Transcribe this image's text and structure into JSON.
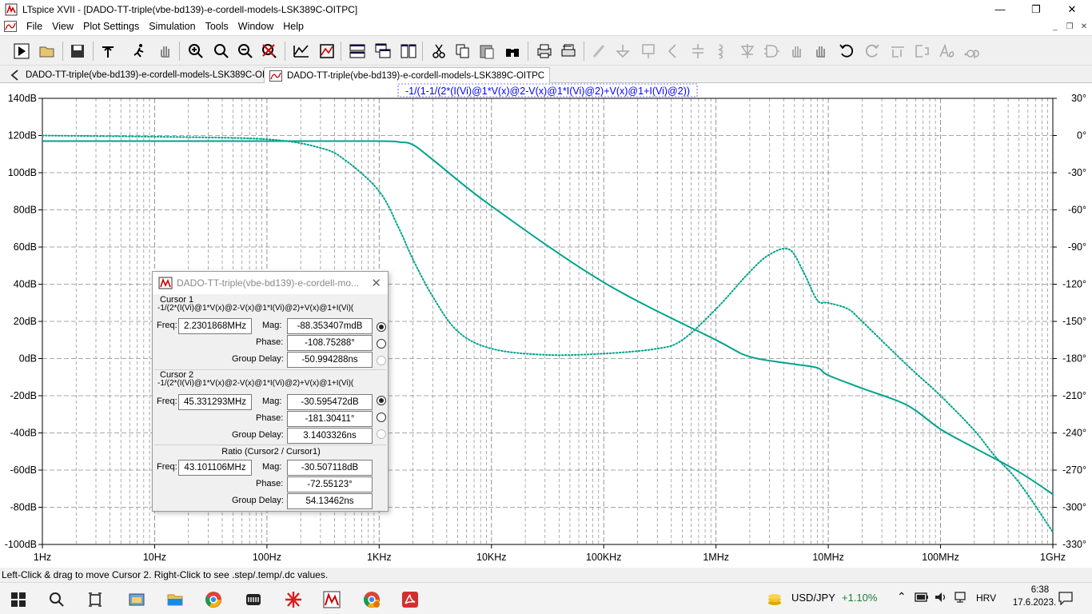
{
  "window": {
    "title": "LTspice XVII - [DADO-TT-triple(vbe-bd139)-e-cordell-models-LSK389C-OITPC]",
    "minimize": "—",
    "restore": "❐",
    "close": "✕"
  },
  "menu": {
    "items": [
      "File",
      "View",
      "Plot Settings",
      "Simulation",
      "Tools",
      "Window",
      "Help"
    ],
    "mdi_min": "_",
    "mdi_restore": "❐",
    "mdi_close": "✕"
  },
  "toolbar": {
    "icons": [
      "run-icon",
      "open-icon",
      "save-icon",
      "control-panel-icon",
      "halt-icon",
      "pan-icon",
      "zoom-in-icon",
      "zoom-area-icon",
      "zoom-out-icon",
      "zoom-cancel-icon",
      "autorange-icon",
      "plot-settings-icon",
      "tile-horizontal-icon",
      "cascade-icon",
      "tile-vertical-icon",
      "cut-icon",
      "copy-icon",
      "paste-icon",
      "find-icon",
      "print-icon",
      "print-setup-icon",
      "wire-icon",
      "ground-icon",
      "label-icon",
      "resistor-icon",
      "capacitor-icon",
      "inductor-icon",
      "diode-icon",
      "component-icon",
      "move-icon",
      "drag-icon",
      "undo-icon",
      "redo-icon",
      "rotate-icon",
      "mirror-icon",
      "text-icon",
      "spice-directive-icon"
    ]
  },
  "tabs": [
    {
      "label": "DADO-TT-triple(vbe-bd139)-e-cordell-models-LSK389C-OITPC",
      "icon": "schematic-icon"
    },
    {
      "label": "DADO-TT-triple(vbe-bd139)-e-cordell-models-LSK389C-OITPC",
      "icon": "waveform-icon"
    }
  ],
  "chart_data": {
    "type": "line",
    "title": "-1/(1-1/(2*(I(Vi)@1*V(x)@2-V(x)@1*I(Vi)@2)+V(x)@1+I(Vi)@2))",
    "x_scale": "log",
    "xlim": [
      1,
      1000000000
    ],
    "x_ticks": [
      "1Hz",
      "10Hz",
      "100Hz",
      "1KHz",
      "10KHz",
      "100KHz",
      "1MHz",
      "10MHz",
      "100MHz",
      "1GHz"
    ],
    "ylim_left": [
      -100,
      140
    ],
    "y_ticks_left": [
      "140dB",
      "120dB",
      "100dB",
      "80dB",
      "60dB",
      "40dB",
      "20dB",
      "0dB",
      "-20dB",
      "-40dB",
      "-60dB",
      "-80dB",
      "-100dB"
    ],
    "ylim_right": [
      -330,
      30
    ],
    "y_ticks_right": [
      "30°",
      "0°",
      "-30°",
      "-60°",
      "-90°",
      "-120°",
      "-150°",
      "-180°",
      "-210°",
      "-240°",
      "-270°",
      "-300°",
      "-330°"
    ],
    "grid": true,
    "color": "#00a38c",
    "series": [
      {
        "name": "magnitude",
        "style": "solid",
        "axis": "left",
        "x": [
          1,
          10,
          100,
          1000,
          1500,
          2000,
          3000,
          10000,
          100000,
          1000000,
          2000000,
          5000000,
          8000000,
          10000000,
          20000000,
          50000000,
          100000000,
          200000000,
          500000000,
          1000000000
        ],
        "y": [
          117,
          117,
          117,
          117,
          116.5,
          115,
          107,
          82,
          41,
          10,
          1,
          -3,
          -5,
          -9,
          -16,
          -25,
          -38,
          -48,
          -61,
          -73
        ]
      },
      {
        "name": "phase",
        "style": "dotted",
        "axis": "right",
        "x": [
          1,
          10,
          100,
          300,
          500,
          1000,
          1500,
          2000,
          3000,
          5000,
          10000,
          30000,
          100000,
          300000,
          500000,
          1000000,
          2000000,
          3000000,
          4500000,
          6000000,
          8000000,
          10000000,
          15000000,
          20000000,
          50000000,
          100000000,
          200000000,
          300000000,
          500000000,
          1000000000
        ],
        "y": [
          0,
          -1,
          -3,
          -10,
          -20,
          -45,
          -75,
          -100,
          -130,
          -158,
          -172,
          -177,
          -176,
          -172,
          -165,
          -140,
          -110,
          -96,
          -92,
          -110,
          -133,
          -135,
          -140,
          -150,
          -185,
          -210,
          -238,
          -258,
          -280,
          -320
        ]
      }
    ]
  },
  "cursor_dialog": {
    "title": "DADO-TT-triple(vbe-bd139)-e-cordell-mo...",
    "close": "✕",
    "cursor1": {
      "heading": "Cursor 1",
      "expr": "-1/(2*(I(Vi)@1*V(x)@2-V(x)@1*I(Vi)@2)+V(x)@1+I(Vi)(",
      "freq_label": "Freq:",
      "freq": "2.2301868MHz",
      "mag_label": "Mag:",
      "mag": "-88.353407mdB",
      "phase_label": "Phase:",
      "phase": "-108.75288°",
      "gd_label": "Group Delay:",
      "gd": "-50.994288ns"
    },
    "cursor2": {
      "heading": "Cursor 2",
      "expr": "-1/(2*(I(Vi)@1*V(x)@2-V(x)@1*I(Vi)@2)+V(x)@1+I(Vi)(",
      "freq_label": "Freq:",
      "freq": "45.331293MHz",
      "mag_label": "Mag:",
      "mag": "-30.595472dB",
      "phase_label": "Phase:",
      "phase": "-181.30411°",
      "gd_label": "Group Delay:",
      "gd": "3.1403326ns"
    },
    "ratio": {
      "heading": "Ratio (Cursor2 / Cursor1)",
      "freq_label": "Freq:",
      "freq": "43.101106MHz",
      "mag_label": "Mag:",
      "mag": "-30.507118dB",
      "phase_label": "Phase:",
      "phase": "-72.55123°",
      "gd_label": "Group Delay:",
      "gd": "54.13462ns"
    }
  },
  "status": "Left-Click & drag to move Cursor 2.  Right-Click to see .step/.temp/.dc values.",
  "taskbar": {
    "apps": [
      "start-icon",
      "search-icon",
      "task-view-icon",
      "file-explorer-icon",
      "folder-icon",
      "chrome-icon",
      "app-icon",
      "ltspice-schematic-icon",
      "ltspice-icon",
      "chrome-profile-icon",
      "acrobat-icon"
    ],
    "ticker": "USD/JPY",
    "ticker_change": "+1.10%",
    "lang": "HRV",
    "time": "6:38",
    "date": "17.6.2023.",
    "ticker_color": "#1a7f37"
  }
}
